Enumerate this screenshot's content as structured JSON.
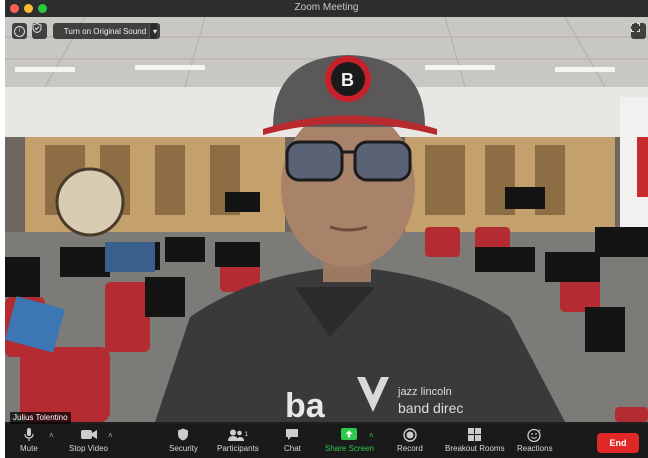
{
  "window": {
    "title": "Zoom Meeting"
  },
  "top_overlay": {
    "sound_button_label": "Turn on Original Sound"
  },
  "participant": {
    "name": "Julius Tolentino"
  },
  "toolbar": {
    "mute_label": "Mute",
    "stop_video_label": "Stop Video",
    "security_label": "Security",
    "participants_label": "Participants",
    "participants_count": "1",
    "chat_label": "Chat",
    "share_screen_label": "Share Screen",
    "record_label": "Record",
    "breakout_rooms_label": "Breakout Rooms",
    "reactions_label": "Reactions",
    "end_label": "End"
  },
  "colors": {
    "end_button": "#e02828",
    "share_accent": "#2dc84d",
    "toolbar_bg": "#1a1a1a"
  },
  "icons": [
    "microphone-icon",
    "video-camera-icon",
    "shield-icon",
    "participants-icon",
    "chat-icon",
    "share-screen-icon",
    "record-icon",
    "breakout-rooms-icon",
    "reactions-icon",
    "info-icon",
    "fullscreen-icon"
  ]
}
